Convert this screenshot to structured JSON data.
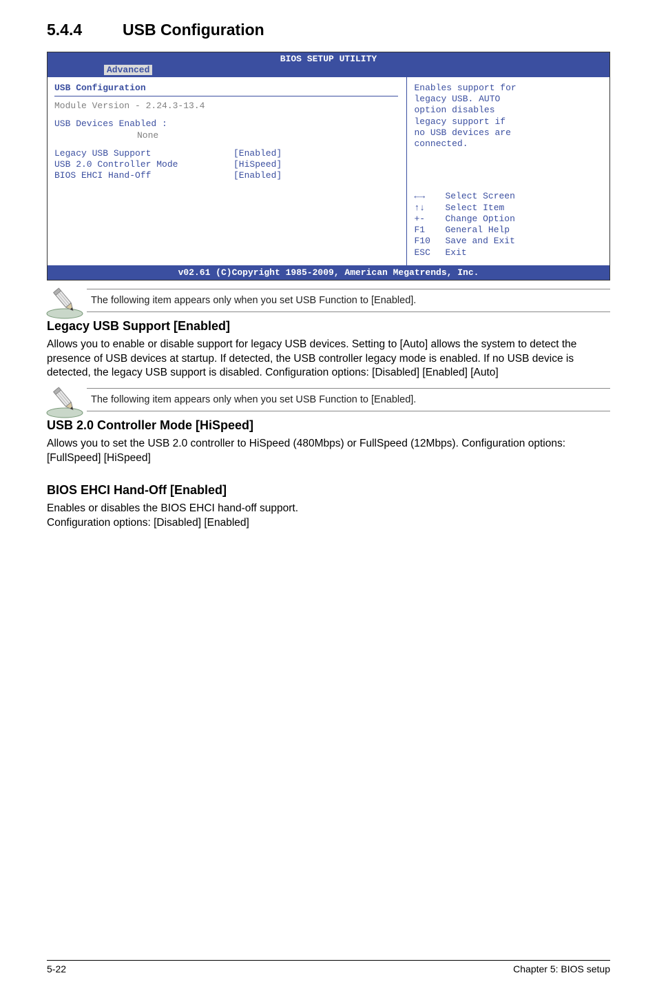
{
  "section": {
    "number": "5.4.4",
    "title": "USB Configuration"
  },
  "bios": {
    "utility_title": "BIOS SETUP UTILITY",
    "tab": "Advanced",
    "panel_title": "USB Configuration",
    "module_version_line": "Module Version - 2.24.3-13.4",
    "devices_enabled_label": "USB Devices Enabled :",
    "devices_enabled_value": "None",
    "rows": [
      {
        "label": "Legacy USB Support",
        "value": "[Enabled]"
      },
      {
        "label": "USB 2.0 Controller Mode",
        "value": "[HiSpeed]"
      },
      {
        "label": "BIOS EHCI Hand-Off",
        "value": "[Enabled]"
      }
    ],
    "help_text_lines": [
      "Enables support for",
      "legacy USB. AUTO",
      "option disables",
      "legacy support if",
      "no USB devices are",
      "connected."
    ],
    "help_keys": [
      {
        "key": "←→",
        "desc": "Select Screen"
      },
      {
        "key": "↑↓",
        "desc": "Select Item"
      },
      {
        "key": "+-",
        "desc": "Change Option"
      },
      {
        "key": "F1",
        "desc": "General Help"
      },
      {
        "key": "F10",
        "desc": "Save and Exit"
      },
      {
        "key": "ESC",
        "desc": "Exit"
      }
    ],
    "footer": "v02.61 (C)Copyright 1985-2009, American Megatrends, Inc."
  },
  "notes": {
    "note1": "The following item appears only when you set USB Function to [Enabled].",
    "note2": "The following item appears only when you set USB Function to [Enabled]."
  },
  "subsections": {
    "s1_heading": "Legacy USB Support [Enabled]",
    "s1_body": "Allows you to enable or disable support for legacy USB devices. Setting to [Auto] allows the system to detect the presence of USB devices at startup. If detected, the USB controller legacy mode is enabled. If no USB device is detected, the legacy USB support is disabled. Configuration options: [Disabled] [Enabled] [Auto]",
    "s2_heading": "USB 2.0 Controller Mode [HiSpeed]",
    "s2_body": "Allows you to set the USB 2.0 controller to HiSpeed (480Mbps) or FullSpeed (12Mbps). Configuration options: [FullSpeed] [HiSpeed]",
    "s3_heading": "BIOS EHCI Hand-Off [Enabled]",
    "s3_body1": "Enables or disables the BIOS EHCI hand-off support.",
    "s3_body2": "Configuration options: [Disabled] [Enabled]"
  },
  "footer": {
    "left": "5-22",
    "right": "Chapter 5: BIOS setup"
  }
}
